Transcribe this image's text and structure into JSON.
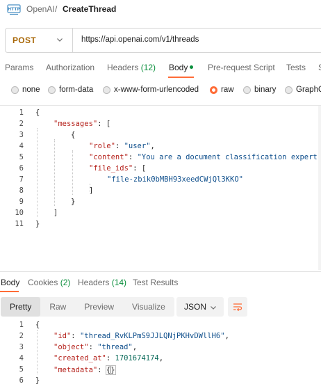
{
  "header": {
    "collection": "OpenAI",
    "separator": "/",
    "title": "CreateThread",
    "icon": "http-request-icon"
  },
  "request": {
    "method": "POST",
    "url": "https://api.openai.com/v1/threads",
    "tabs": [
      {
        "label": "Params"
      },
      {
        "label": "Authorization"
      },
      {
        "label": "Headers",
        "count": "(12)"
      },
      {
        "label": "Body",
        "active": true
      },
      {
        "label": "Pre-request Script"
      },
      {
        "label": "Tests"
      },
      {
        "label": "S"
      }
    ],
    "body_types": [
      {
        "label": "none"
      },
      {
        "label": "form-data"
      },
      {
        "label": "x-www-form-urlencoded"
      },
      {
        "label": "raw",
        "selected": true
      },
      {
        "label": "binary"
      },
      {
        "label": "GraphQL"
      }
    ],
    "line_numbers": [
      "1",
      "2",
      "3",
      "4",
      "5",
      "6",
      "7",
      "8",
      "9",
      "10",
      "11"
    ],
    "body_lines": {
      "l1": "{",
      "l2_key": "\"messages\"",
      "l2_rest": ": [",
      "l3": "{",
      "l4_key": "\"role\"",
      "l4_colon": ": ",
      "l4_val": "\"user\"",
      "l4_end": ",",
      "l5_key": "\"content\"",
      "l5_colon": ": ",
      "l5_val": "\"You are a document classification expert.",
      "l6_key": "\"file_ids\"",
      "l6_rest": ": [",
      "l7_val": "\"file-zbik0bMBH93xeedCWjQl3KKO\"",
      "l8": "]",
      "l9": "}",
      "l10": "]",
      "l11": "}"
    }
  },
  "response": {
    "tabs": [
      {
        "label": "Body",
        "active": true
      },
      {
        "label": "Cookies",
        "count": "(2)"
      },
      {
        "label": "Headers",
        "count": "(14)"
      },
      {
        "label": "Test Results"
      }
    ],
    "view_modes": [
      "Pretty",
      "Raw",
      "Preview",
      "Visualize"
    ],
    "format": "JSON",
    "line_numbers": [
      "1",
      "2",
      "3",
      "4",
      "5",
      "6"
    ],
    "lines": {
      "l1": "{",
      "l2_key": "\"id\"",
      "l2_colon": ": ",
      "l2_val": "\"thread_RvKLPmS9JJLQNjPKHvDWllH6\"",
      "l2_end": ",",
      "l3_key": "\"object\"",
      "l3_colon": ": ",
      "l3_val": "\"thread\"",
      "l3_end": ",",
      "l4_key": "\"created_at\"",
      "l4_colon": ": ",
      "l4_val": "1701674174",
      "l4_end": ",",
      "l5_key": "\"metadata\"",
      "l5_colon": ": ",
      "l5_val_open": "{",
      "l5_val_close": "}",
      "l6": "}"
    }
  },
  "colors": {
    "accent": "#ff6c37",
    "method": "#a86707",
    "count": "#0a8f3c",
    "json_key": "#b5221c",
    "json_string": "#0f4f8c",
    "json_number": "#0b6b5a"
  }
}
